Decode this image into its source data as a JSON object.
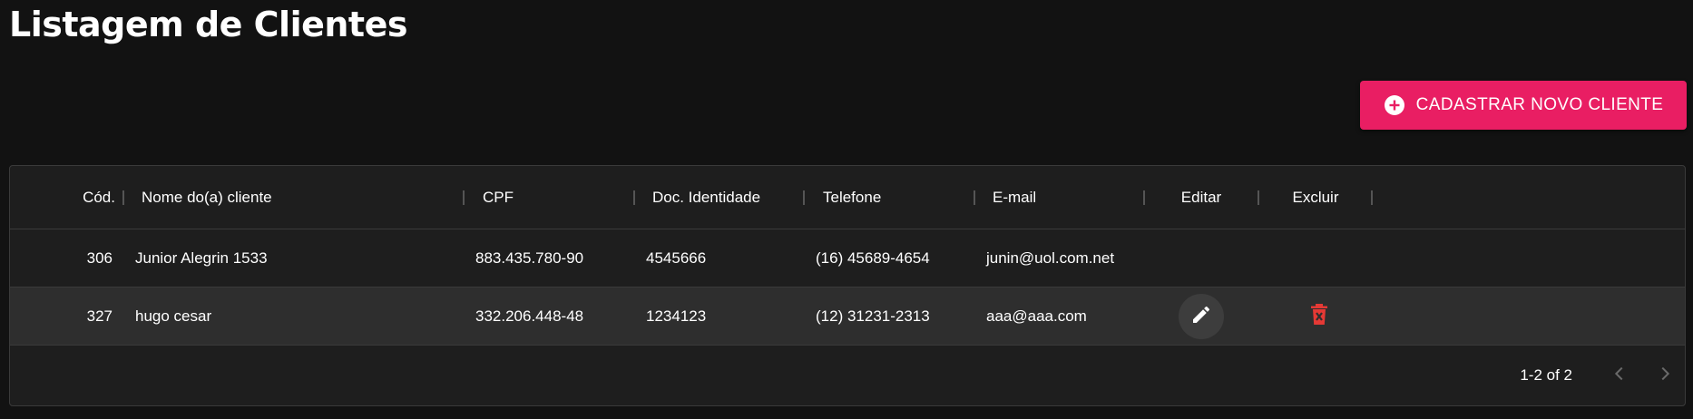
{
  "page": {
    "title": "Listagem de Clientes"
  },
  "actions": {
    "add_label": "CADASTRAR NOVO CLIENTE",
    "add_icon": "plus-circle-icon",
    "accent_color": "#e91e63"
  },
  "table": {
    "columns": [
      {
        "key": "codigo",
        "label": "Cód."
      },
      {
        "key": "nome",
        "label": "Nome do(a) cliente"
      },
      {
        "key": "cpf",
        "label": "CPF"
      },
      {
        "key": "rg",
        "label": "Doc. Identidade"
      },
      {
        "key": "telefone",
        "label": "Telefone"
      },
      {
        "key": "email",
        "label": "E-mail"
      },
      {
        "key": "editar",
        "label": "Editar"
      },
      {
        "key": "excluir",
        "label": "Excluir"
      }
    ],
    "rows": [
      {
        "codigo": "306",
        "nome": "Junior Alegrin 1533",
        "cpf": "883.435.780-90",
        "rg": "4545666",
        "telefone": "(16) 45689-4654",
        "email": "junin@uol.com.net"
      },
      {
        "codigo": "327",
        "nome": "hugo cesar",
        "cpf": "332.206.448-48",
        "rg": "1234123",
        "telefone": "(12) 31231-2313",
        "email": "aaa@aaa.com"
      }
    ],
    "icons": {
      "edit": "pencil-icon",
      "delete": "trash-icon",
      "delete_color": "#e53935"
    },
    "pagination": {
      "label": "1-2 of 2",
      "prev_icon": "chevron-left-icon",
      "next_icon": "chevron-right-icon"
    }
  }
}
